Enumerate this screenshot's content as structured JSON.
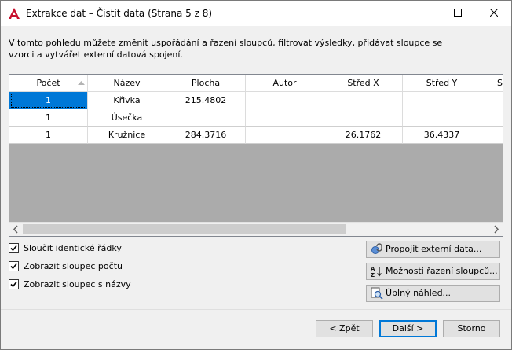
{
  "window": {
    "title": "Extrakce dat – Čistit data (Strana 5 z 8)"
  },
  "description": "V tomto pohledu můžete změnit uspořádání a řazení sloupců, filtrovat výsledky, přidávat sloupce se vzorci a vytvářet externí datová spojení.",
  "table": {
    "columns": [
      "Počet",
      "Název",
      "Plocha",
      "Autor",
      "Střed X",
      "Střed Y",
      "S"
    ],
    "rows": [
      [
        "1",
        "Křivka",
        "215.4802",
        "",
        "",
        "",
        ""
      ],
      [
        "1",
        "Úsečka",
        "",
        "",
        "",
        "",
        ""
      ],
      [
        "1",
        "Kružnice",
        "284.3716",
        "",
        "26.1762",
        "36.4337",
        ""
      ]
    ],
    "sort_icon": "sort-ascending-icon"
  },
  "options": {
    "merge_rows": {
      "label": "Sloučit identické řádky",
      "checked": true
    },
    "show_count": {
      "label": "Zobrazit sloupec počtu",
      "checked": true
    },
    "show_name": {
      "label": "Zobrazit sloupec s názvy",
      "checked": true
    }
  },
  "side_buttons": {
    "link_external": "Propojit externí data...",
    "sort_options": "Možnosti řazení sloupců...",
    "full_preview": "Úplný náhled..."
  },
  "footer": {
    "back": "< Zpět",
    "next": "Další >",
    "cancel": "Storno"
  },
  "colors": {
    "selection": "#0078d7",
    "app_icon": "#c8102e",
    "empty_grid": "#ababab"
  }
}
